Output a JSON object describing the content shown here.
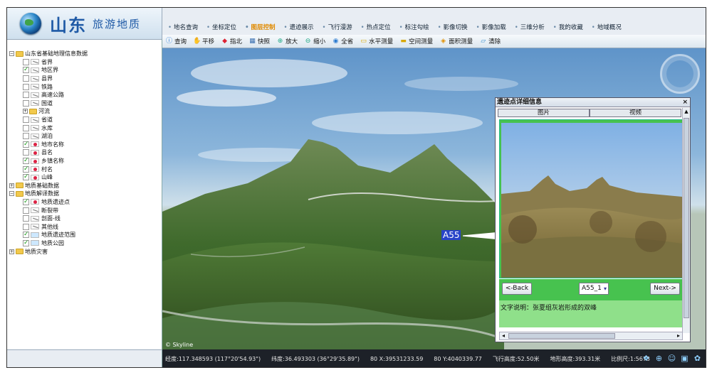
{
  "logo": {
    "title": "山东",
    "subtitle": "旅游地质"
  },
  "menu": [
    {
      "label": "地名查询"
    },
    {
      "label": "坐标定位"
    },
    {
      "label": "图层控制",
      "active": true
    },
    {
      "label": "遗迹展示"
    },
    {
      "label": "飞行漫游"
    },
    {
      "label": "热点定位"
    },
    {
      "label": "标注勾绘"
    },
    {
      "label": "影像切换"
    },
    {
      "label": "影像加载"
    },
    {
      "label": "三维分析"
    },
    {
      "label": "我的收藏"
    },
    {
      "label": "地域概况"
    }
  ],
  "toolbar": [
    {
      "label": "查询",
      "icon": "info-icon"
    },
    {
      "label": "平移",
      "icon": "hand-icon"
    },
    {
      "label": "指北",
      "icon": "north-arrow-icon"
    },
    {
      "label": "快照",
      "icon": "snapshot-icon"
    },
    {
      "label": "放大",
      "icon": "zoom-in-icon"
    },
    {
      "label": "缩小",
      "icon": "zoom-out-icon"
    },
    {
      "label": "全省",
      "icon": "globe-icon"
    },
    {
      "label": "水平测量",
      "icon": "ruler-icon"
    },
    {
      "label": "空间测量",
      "icon": "ruler-3d-icon"
    },
    {
      "label": "面积测量",
      "icon": "area-icon"
    },
    {
      "label": "清除",
      "icon": "eraser-icon"
    }
  ],
  "tree": [
    {
      "label": "山东省基础地理信息数据",
      "level": 0,
      "type": "group",
      "expanded": true
    },
    {
      "label": "省界",
      "level": 1,
      "checked": false,
      "icon": "ln"
    },
    {
      "label": "地区界",
      "level": 1,
      "checked": true,
      "icon": "ln"
    },
    {
      "label": "县界",
      "level": 1,
      "checked": false,
      "icon": "ln"
    },
    {
      "label": "铁路",
      "level": 1,
      "checked": false,
      "icon": "ln"
    },
    {
      "label": "高速公路",
      "level": 1,
      "checked": false,
      "icon": "ln"
    },
    {
      "label": "国道",
      "level": 1,
      "checked": false,
      "icon": "ln"
    },
    {
      "label": "河流",
      "level": 1,
      "type": "group",
      "expanded": false
    },
    {
      "label": "省道",
      "level": 1,
      "checked": false,
      "icon": "ln"
    },
    {
      "label": "水库",
      "level": 1,
      "checked": false,
      "icon": "ln"
    },
    {
      "label": "湖泊",
      "level": 1,
      "checked": false,
      "icon": "ln"
    },
    {
      "label": "地市名称",
      "level": 1,
      "checked": true,
      "icon": "dot"
    },
    {
      "label": "县名",
      "level": 1,
      "checked": false,
      "icon": "dot"
    },
    {
      "label": "乡镇名称",
      "level": 1,
      "checked": true,
      "icon": "dot"
    },
    {
      "label": "村名",
      "level": 1,
      "checked": true,
      "icon": "dot"
    },
    {
      "label": "山峰",
      "level": 1,
      "checked": true,
      "icon": "dot"
    },
    {
      "label": "地质基础数据",
      "level": 0,
      "type": "group",
      "expanded": false
    },
    {
      "label": "地质解译数据",
      "level": 0,
      "type": "group",
      "expanded": true
    },
    {
      "label": "地质遗迹点",
      "level": 1,
      "checked": true,
      "icon": "dot"
    },
    {
      "label": "断裂带",
      "level": 1,
      "checked": false,
      "icon": "ln"
    },
    {
      "label": "剖面-线",
      "level": 1,
      "checked": false,
      "icon": "ln"
    },
    {
      "label": "其他线",
      "level": 1,
      "checked": false,
      "icon": "ln"
    },
    {
      "label": "地质遗迹范围",
      "level": 1,
      "checked": true,
      "icon": "poly"
    },
    {
      "label": "地质公园",
      "level": 1,
      "checked": true,
      "icon": "poly"
    },
    {
      "label": "地质灾害",
      "level": 0,
      "type": "group",
      "expanded": false
    }
  ],
  "map": {
    "marker_label": "A55",
    "watermark": "© Skyline"
  },
  "popup": {
    "title": "遗迹点详细信息",
    "close": "×",
    "tabs": [
      {
        "label": "图片"
      },
      {
        "label": "视频"
      }
    ],
    "back_label": "<-Back",
    "next_label": "Next->",
    "select_value": "A55_1",
    "description": "文字说明：张夏组灰岩形成的双峰"
  },
  "status": {
    "lon": "经度:117.348593 (117°20'54.93\")",
    "lat": "纬度:36.493303 (36°29'35.89\")",
    "x": "80 X:39531233.59",
    "y": "80 Y:4040339.77",
    "flight_height": "飞行高度:52.50米",
    "terrain_height": "地形高度:393.31米",
    "scale": "比例尺:1:5673"
  },
  "status_icons": [
    "paw-icon",
    "center-icon",
    "smile-icon",
    "image-icon",
    "settings-icon"
  ],
  "colors": {
    "accent": "#e08a00",
    "popup_green": "#47c24f",
    "brand": "#1f5aa6"
  }
}
